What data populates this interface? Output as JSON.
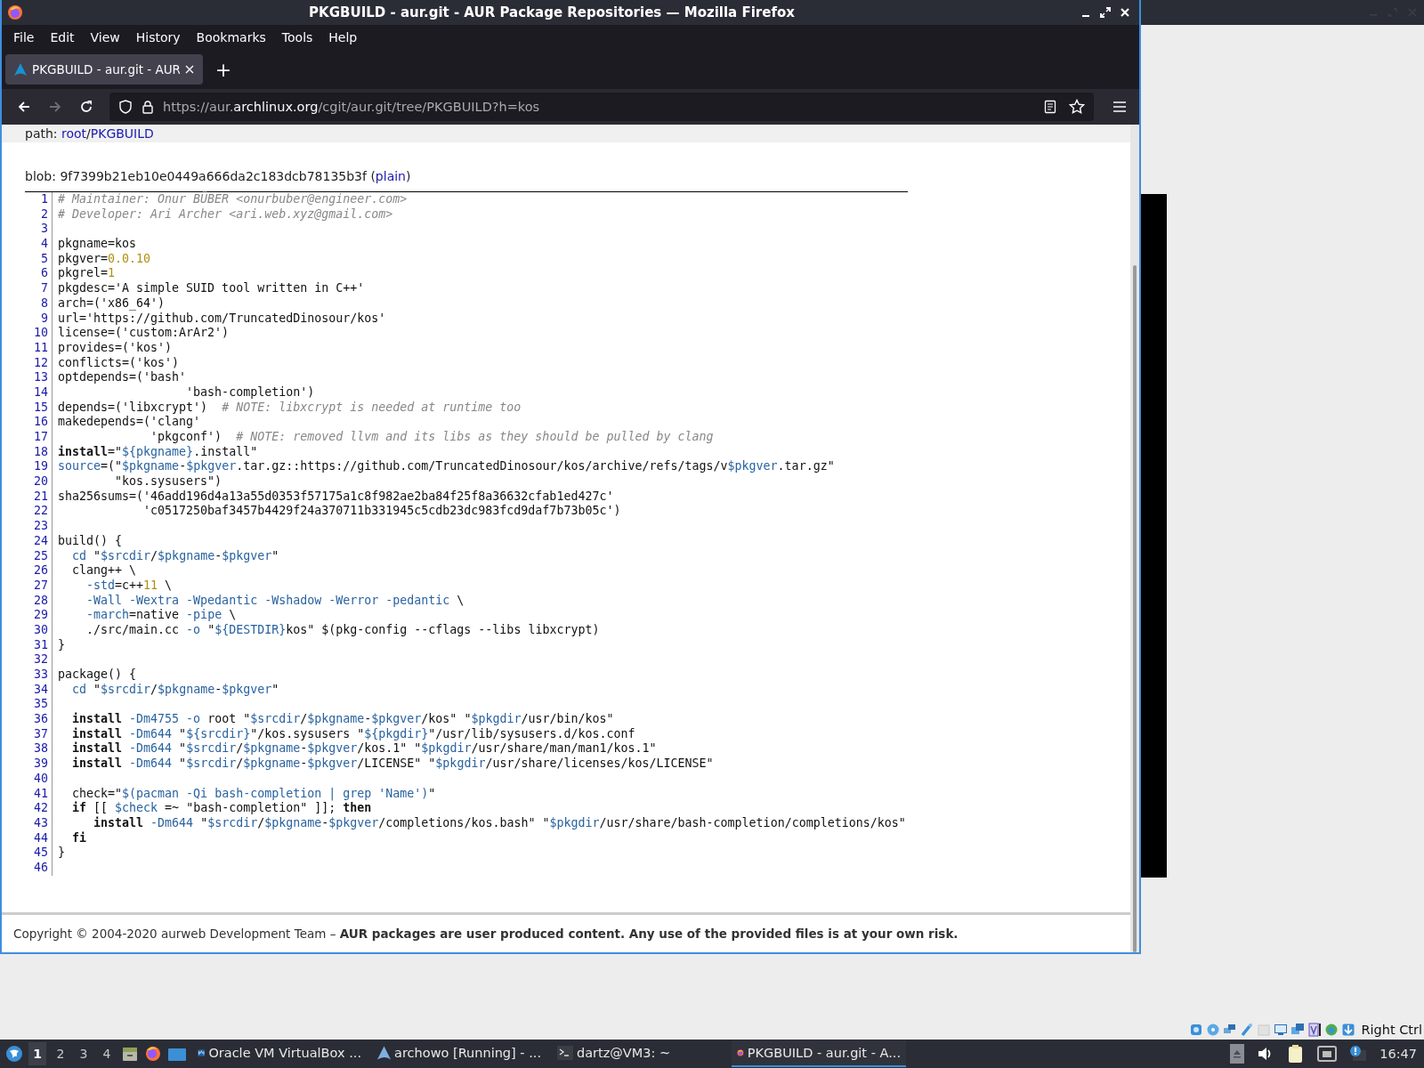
{
  "window": {
    "title": "PKGBUILD - aur.git - AUR Package Repositories — Mozilla Firefox"
  },
  "menu": [
    "File",
    "Edit",
    "View",
    "History",
    "Bookmarks",
    "Tools",
    "Help"
  ],
  "tabs": [
    {
      "label": "PKGBUILD - aur.git - AUR",
      "selected": true
    }
  ],
  "new_tab": "+",
  "nav_buttons": [
    {
      "kind": "back",
      "disabled": false
    },
    {
      "kind": "forward",
      "disabled": true
    },
    {
      "kind": "reload",
      "disabled": false
    }
  ],
  "url": [
    {
      "text": "https://aur.",
      "highlight": false
    },
    {
      "text": "archlinux.org",
      "highlight": true
    },
    {
      "text": "/cgit/aur.git/tree/PKGBUILD?h=kos",
      "highlight": false
    }
  ],
  "breadcrumb": {
    "label": "path: ",
    "links": [
      "root",
      "PKGBUILD"
    ],
    "separator": "/"
  },
  "blob": {
    "text": "blob: 9f7399b21eb10e0449a666da2c183dcb78135b3f (",
    "link": "plain",
    "after": ")"
  },
  "code": [
    {
      "number": "1",
      "tokens": [
        {
          "kind": "comment",
          "text": "# Maintainer: Onur BÜBER <onurbuber@engineer.com>"
        }
      ]
    },
    {
      "number": "2",
      "tokens": [
        {
          "kind": "comment",
          "text": "# Developer: Ari Archer <ari.web.xyz@gmail.com>"
        }
      ]
    },
    {
      "number": "3"
    },
    {
      "number": "4",
      "tokens": [
        {
          "kind": "plain",
          "text": "pkgname=kos"
        }
      ]
    },
    {
      "number": "5",
      "tokens": [
        {
          "kind": "plain",
          "text": "pkgver="
        },
        {
          "kind": "number",
          "text": "0.0.10"
        }
      ]
    },
    {
      "number": "6",
      "tokens": [
        {
          "kind": "plain",
          "text": "pkgrel="
        },
        {
          "kind": "number",
          "text": "1"
        }
      ]
    },
    {
      "number": "7",
      "tokens": [
        {
          "kind": "plain",
          "text": "pkgdesc='A simple SUID tool written in C++'"
        }
      ]
    },
    {
      "number": "8",
      "tokens": [
        {
          "kind": "plain",
          "text": "arch=('x86_64')"
        }
      ]
    },
    {
      "number": "9",
      "tokens": [
        {
          "kind": "plain",
          "text": "url='https://github.com/TruncatedDinosour/kos'"
        }
      ]
    },
    {
      "number": "10",
      "tokens": [
        {
          "kind": "plain",
          "text": "license=('custom:ArAr2')"
        }
      ]
    },
    {
      "number": "11",
      "tokens": [
        {
          "kind": "plain",
          "text": "provides=('kos')"
        }
      ]
    },
    {
      "number": "12",
      "tokens": [
        {
          "kind": "plain",
          "text": "conflicts=('kos')"
        }
      ]
    },
    {
      "number": "13",
      "tokens": [
        {
          "kind": "plain",
          "text": "optdepends=('bash'"
        }
      ]
    },
    {
      "number": "14",
      "tokens": [
        {
          "kind": "plain",
          "text": "                  'bash-completion')"
        }
      ]
    },
    {
      "number": "15",
      "tokens": [
        {
          "kind": "plain",
          "text": "depends=('libxcrypt')  "
        },
        {
          "kind": "comment",
          "text": "# NOTE: libxcrypt is needed at runtime too"
        }
      ]
    },
    {
      "number": "16",
      "tokens": [
        {
          "kind": "plain",
          "text": "makedepends=('clang'"
        }
      ]
    },
    {
      "number": "17",
      "tokens": [
        {
          "kind": "plain",
          "text": "             'pkgconf')  "
        },
        {
          "kind": "comment",
          "text": "# NOTE: removed llvm and its libs as they should be pulled by clang"
        }
      ]
    },
    {
      "number": "18",
      "tokens": [
        {
          "kind": "keyword",
          "text": "install"
        },
        {
          "kind": "plain",
          "text": "=\""
        },
        {
          "kind": "var",
          "text": "${pkgname}"
        },
        {
          "kind": "plain",
          "text": ".install\""
        }
      ]
    },
    {
      "number": "19",
      "tokens": [
        {
          "kind": "var",
          "text": "source"
        },
        {
          "kind": "plain",
          "text": "=(\""
        },
        {
          "kind": "var",
          "text": "$pkgname"
        },
        {
          "kind": "plain",
          "text": "-"
        },
        {
          "kind": "var",
          "text": "$pkgver"
        },
        {
          "kind": "plain",
          "text": ".tar.gz::https://github.com/TruncatedDinosour/kos/archive/refs/tags/v"
        },
        {
          "kind": "var",
          "text": "$pkgver"
        },
        {
          "kind": "plain",
          "text": ".tar.gz\""
        }
      ]
    },
    {
      "number": "20",
      "tokens": [
        {
          "kind": "plain",
          "text": "        \"kos.sysusers\")"
        }
      ]
    },
    {
      "number": "21",
      "tokens": [
        {
          "kind": "plain",
          "text": "sha256sums=('46add196d4a13a55d0353f57175a1c8f982ae2ba84f25f8a36632cfab1ed427c'"
        }
      ]
    },
    {
      "number": "22",
      "tokens": [
        {
          "kind": "plain",
          "text": "            'c0517250baf3457b4429f24a370711b331945c5cdb23dc983fcd9daf7b73b05c')"
        }
      ]
    },
    {
      "number": "23"
    },
    {
      "number": "24",
      "tokens": [
        {
          "kind": "plain",
          "text": "build() {"
        }
      ]
    },
    {
      "number": "25",
      "tokens": [
        {
          "kind": "var",
          "text": "  cd"
        },
        {
          "kind": "plain",
          "text": " \""
        },
        {
          "kind": "var",
          "text": "$srcdir"
        },
        {
          "kind": "plain",
          "text": "/"
        },
        {
          "kind": "var",
          "text": "$pkgname"
        },
        {
          "kind": "plain",
          "text": "-"
        },
        {
          "kind": "var",
          "text": "$pkgver"
        },
        {
          "kind": "plain",
          "text": "\""
        }
      ]
    },
    {
      "number": "26",
      "tokens": [
        {
          "kind": "plain",
          "text": "  clang++ \\"
        }
      ]
    },
    {
      "number": "27",
      "tokens": [
        {
          "kind": "var",
          "text": "    -std"
        },
        {
          "kind": "plain",
          "text": "=c++"
        },
        {
          "kind": "number",
          "text": "11"
        },
        {
          "kind": "plain",
          "text": " \\"
        }
      ]
    },
    {
      "number": "28",
      "tokens": [
        {
          "kind": "var",
          "text": "    -Wall -Wextra -Wpedantic -Wshadow -Werror -pedantic"
        },
        {
          "kind": "plain",
          "text": " \\"
        }
      ]
    },
    {
      "number": "29",
      "tokens": [
        {
          "kind": "var",
          "text": "    -march"
        },
        {
          "kind": "plain",
          "text": "=native "
        },
        {
          "kind": "var",
          "text": "-pipe"
        },
        {
          "kind": "plain",
          "text": " \\"
        }
      ]
    },
    {
      "number": "30",
      "tokens": [
        {
          "kind": "plain",
          "text": "    ./src/main.cc "
        },
        {
          "kind": "var",
          "text": "-o"
        },
        {
          "kind": "plain",
          "text": " \""
        },
        {
          "kind": "var",
          "text": "${DESTDIR}"
        },
        {
          "kind": "plain",
          "text": "kos\" $(pkg-config --cflags --libs libxcrypt)"
        }
      ]
    },
    {
      "number": "31",
      "tokens": [
        {
          "kind": "plain",
          "text": "}"
        }
      ]
    },
    {
      "number": "32"
    },
    {
      "number": "33",
      "tokens": [
        {
          "kind": "plain",
          "text": "package() {"
        }
      ]
    },
    {
      "number": "34",
      "tokens": [
        {
          "kind": "var",
          "text": "  cd"
        },
        {
          "kind": "plain",
          "text": " \""
        },
        {
          "kind": "var",
          "text": "$srcdir"
        },
        {
          "kind": "plain",
          "text": "/"
        },
        {
          "kind": "var",
          "text": "$pkgname"
        },
        {
          "kind": "plain",
          "text": "-"
        },
        {
          "kind": "var",
          "text": "$pkgver"
        },
        {
          "kind": "plain",
          "text": "\""
        }
      ]
    },
    {
      "number": "35"
    },
    {
      "number": "36",
      "tokens": [
        {
          "kind": "keyword",
          "text": "  install"
        },
        {
          "kind": "var",
          "text": " -Dm4755 -o"
        },
        {
          "kind": "plain",
          "text": " root \""
        },
        {
          "kind": "var",
          "text": "$srcdir"
        },
        {
          "kind": "plain",
          "text": "/"
        },
        {
          "kind": "var",
          "text": "$pkgname"
        },
        {
          "kind": "plain",
          "text": "-"
        },
        {
          "kind": "var",
          "text": "$pkgver"
        },
        {
          "kind": "plain",
          "text": "/kos\" \""
        },
        {
          "kind": "var",
          "text": "$pkgdir"
        },
        {
          "kind": "plain",
          "text": "/usr/bin/kos\""
        }
      ]
    },
    {
      "number": "37",
      "tokens": [
        {
          "kind": "keyword",
          "text": "  install"
        },
        {
          "kind": "var",
          "text": " -Dm644"
        },
        {
          "kind": "plain",
          "text": " \""
        },
        {
          "kind": "var",
          "text": "${srcdir}"
        },
        {
          "kind": "plain",
          "text": "\"/kos.sysusers \""
        },
        {
          "kind": "var",
          "text": "${pkgdir}"
        },
        {
          "kind": "plain",
          "text": "\"/usr/lib/sysusers.d/kos.conf"
        }
      ]
    },
    {
      "number": "38",
      "tokens": [
        {
          "kind": "keyword",
          "text": "  install"
        },
        {
          "kind": "var",
          "text": " -Dm644"
        },
        {
          "kind": "plain",
          "text": " \""
        },
        {
          "kind": "var",
          "text": "$srcdir"
        },
        {
          "kind": "plain",
          "text": "/"
        },
        {
          "kind": "var",
          "text": "$pkgname"
        },
        {
          "kind": "plain",
          "text": "-"
        },
        {
          "kind": "var",
          "text": "$pkgver"
        },
        {
          "kind": "plain",
          "text": "/kos.1\" \""
        },
        {
          "kind": "var",
          "text": "$pkgdir"
        },
        {
          "kind": "plain",
          "text": "/usr/share/man/man1/kos.1\""
        }
      ]
    },
    {
      "number": "39",
      "tokens": [
        {
          "kind": "keyword",
          "text": "  install"
        },
        {
          "kind": "var",
          "text": " -Dm644"
        },
        {
          "kind": "plain",
          "text": " \""
        },
        {
          "kind": "var",
          "text": "$srcdir"
        },
        {
          "kind": "plain",
          "text": "/"
        },
        {
          "kind": "var",
          "text": "$pkgname"
        },
        {
          "kind": "plain",
          "text": "-"
        },
        {
          "kind": "var",
          "text": "$pkgver"
        },
        {
          "kind": "plain",
          "text": "/LICENSE\" \""
        },
        {
          "kind": "var",
          "text": "$pkgdir"
        },
        {
          "kind": "plain",
          "text": "/usr/share/licenses/kos/LICENSE\""
        }
      ]
    },
    {
      "number": "40"
    },
    {
      "number": "41",
      "tokens": [
        {
          "kind": "plain",
          "text": "  check=\""
        },
        {
          "kind": "var",
          "text": "$(pacman -Qi bash-completion | grep 'Name')"
        },
        {
          "kind": "plain",
          "text": "\""
        }
      ]
    },
    {
      "number": "42",
      "tokens": [
        {
          "kind": "keyword",
          "text": "  if"
        },
        {
          "kind": "plain",
          "text": " [[ "
        },
        {
          "kind": "var",
          "text": "$check"
        },
        {
          "kind": "plain",
          "text": " =~ \"bash-completion\" ]]; "
        },
        {
          "kind": "keyword",
          "text": "then"
        }
      ]
    },
    {
      "number": "43",
      "tokens": [
        {
          "kind": "keyword",
          "text": "     install"
        },
        {
          "kind": "var",
          "text": " -Dm644"
        },
        {
          "kind": "plain",
          "text": " \""
        },
        {
          "kind": "var",
          "text": "$srcdir"
        },
        {
          "kind": "plain",
          "text": "/"
        },
        {
          "kind": "var",
          "text": "$pkgname"
        },
        {
          "kind": "plain",
          "text": "-"
        },
        {
          "kind": "var",
          "text": "$pkgver"
        },
        {
          "kind": "plain",
          "text": "/completions/kos.bash\" \""
        },
        {
          "kind": "var",
          "text": "$pkgdir"
        },
        {
          "kind": "plain",
          "text": "/usr/share/bash-completion/completions/kos\""
        }
      ]
    },
    {
      "number": "44",
      "tokens": [
        {
          "kind": "keyword",
          "text": "  fi"
        }
      ]
    },
    {
      "number": "45",
      "tokens": [
        {
          "kind": "plain",
          "text": "}"
        }
      ]
    },
    {
      "number": "46"
    }
  ],
  "footer": "Copyright © 2004-2020 aurweb Development Team – **AUR packages are user produced content. Any use of the provided files is at your own risk.**",
  "vbox_status": {
    "label": "Right Ctrl"
  },
  "taskbar": {
    "workspaces": [
      {
        "label": "1",
        "selected": true
      },
      {
        "label": "2",
        "selected": false
      },
      {
        "label": "3",
        "selected": false
      },
      {
        "label": "4",
        "selected": false
      }
    ],
    "tasks": [
      {
        "kind": "vbox",
        "label": "Oracle VM VirtualBox ...",
        "selected": false
      },
      {
        "kind": "vm",
        "label": "archowo [Running] - ...",
        "selected": false
      },
      {
        "kind": "terminal",
        "label": "dartz@VM3: ~",
        "selected": false
      },
      {
        "kind": "firefox",
        "label": "PKGBUILD - aur.git - A...",
        "selected": true
      }
    ],
    "clock": "16:47"
  }
}
